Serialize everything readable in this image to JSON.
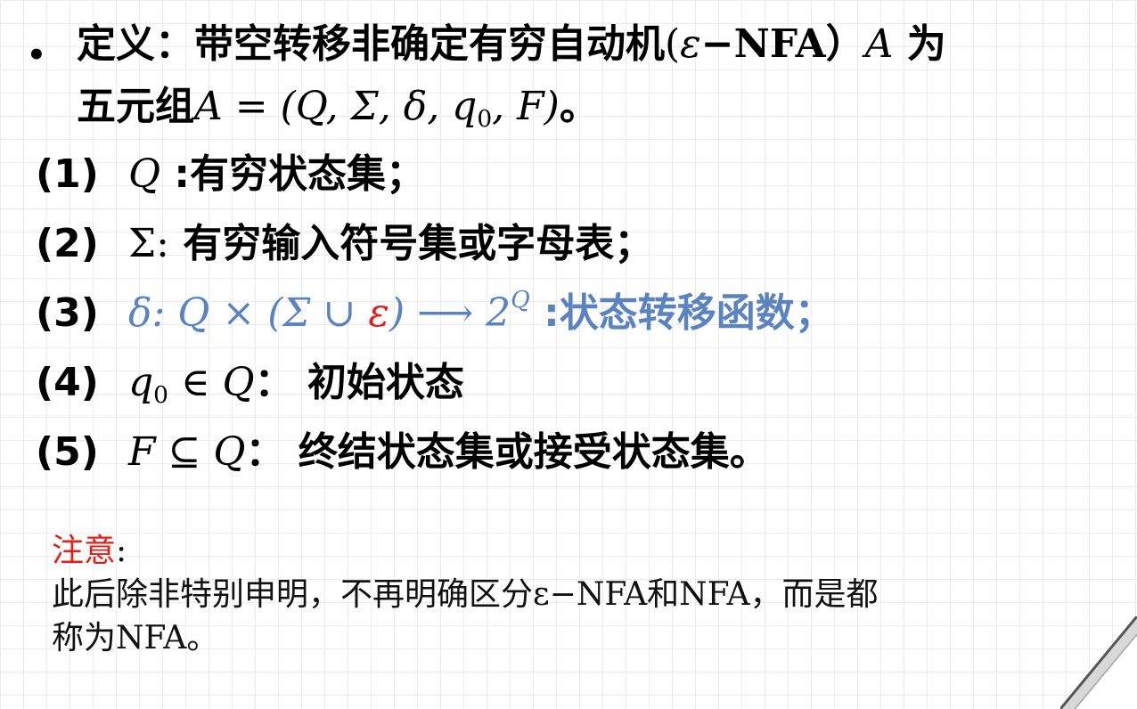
{
  "definition": {
    "bullet": "•",
    "lead": "定义：带空转移非确定有穷自动机",
    "paren_open": "(",
    "eps": "ε",
    "nfa": "−NFA",
    "paren_close": "）",
    "A": "A",
    "wei": " 为",
    "line2_text": "五元组",
    "line2_math": "A = (Q, Σ, δ, q",
    "sub0": "0",
    "line2_tail": ", F)",
    "period": "。"
  },
  "items": [
    {
      "num": "(1)",
      "math": "Q",
      "text": " :有穷状态集；"
    },
    {
      "num": "(2)",
      "math": "Σ:",
      "text": " 有穷输入符号集或字母表；"
    },
    {
      "num": "(3)",
      "math_a": "δ: Q × (Σ ∪ ",
      "eps": "ε",
      "math_b": ") ⟶ 2",
      "sup": "Q",
      "text": " :状态转移函数；"
    },
    {
      "num": "(4)",
      "math_a": "q",
      "sub": "0",
      "math_b": " ∈ Q",
      "text": "： 初始状态"
    },
    {
      "num": "(5)",
      "math": "F ⊆ Q",
      "text": "： 终结状态集或接受状态集。"
    }
  ],
  "note": {
    "title": "注意",
    "colon": ":",
    "line1": "此后除非特别申明，不再明确区分ε−NFA和NFA，而是都",
    "line2": "称为NFA。"
  },
  "colors": {
    "blue": "#5b84bf",
    "red": "#e0201b"
  }
}
